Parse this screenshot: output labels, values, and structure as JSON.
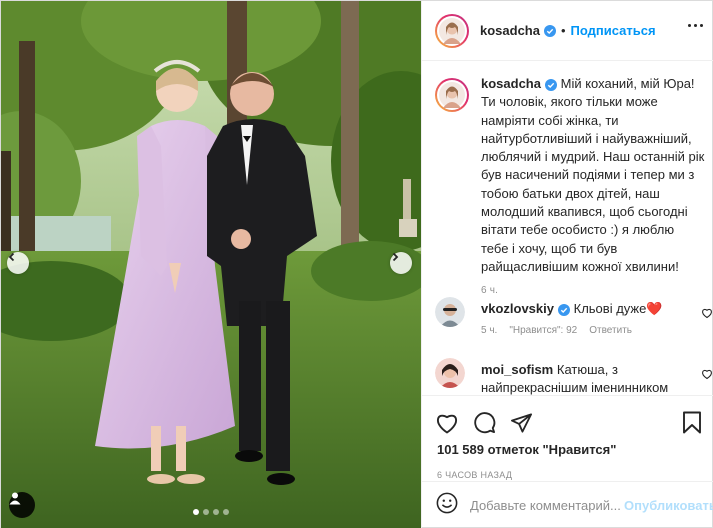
{
  "post": {
    "username": "kosadcha",
    "follow_label": "Подписаться",
    "separator": "•",
    "caption_text": "Мій коханий, мій Юра! Ти чоловік, якого тільки може намріяти собі жінка, ти найтурботливіший і найуважніший, люблячий і мудрий. Наш останній рік був насичений подіями і тепер ми з тобою батьки двох дітей, наш молодший квапився, щоб сьогодні вітати тебе особисто :) я люблю тебе і хочу, щоб ти був райщасливішим кожної хвилини!",
    "caption_time": "6 ч.",
    "likes": "101 589 отметок \"Нравится\"",
    "posted_ago": "6 ЧАСОВ НАЗАД"
  },
  "comments": [
    {
      "username": "vkozlovskiy",
      "text": "Кльові дуже",
      "emoji": "❤️",
      "time": "5 ч.",
      "likes_label": "\"Нравится\": 92",
      "reply_label": "Ответить"
    },
    {
      "username": "moi_sofism",
      "text": "Катюша, з найпрекраснішим іменинником"
    }
  ],
  "composer": {
    "placeholder": "Добавьте комментарий...",
    "publish_label": "Опубликовать"
  },
  "carousel": {
    "slide_count": 4,
    "active_index": 0
  },
  "icons": {
    "like": "heart-icon",
    "comment": "comment-icon",
    "share": "paper-plane-icon",
    "save": "bookmark-icon",
    "emoji": "smiley-icon",
    "more": "more-icon",
    "verified": "verified-badge-icon",
    "tag": "user-tag-icon"
  },
  "colors": {
    "link_blue": "#0095f6",
    "publish_disabled": "#b2dffc",
    "muted_text": "#8e8e8e",
    "verified": "#3897f0",
    "heart_red": "#ed1c24"
  }
}
